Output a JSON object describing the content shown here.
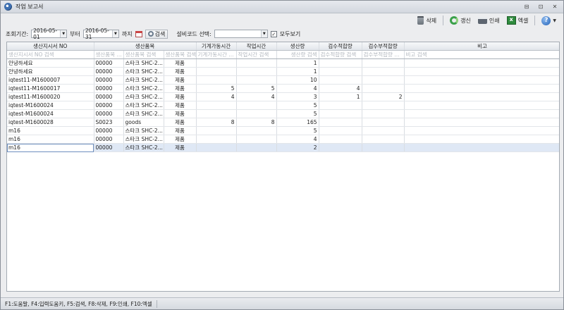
{
  "window": {
    "title": "작업 보고서",
    "min": "⊟",
    "restore": "⊡",
    "close": "✕"
  },
  "toolbar": {
    "delete": "삭제",
    "refresh": "갱신",
    "print": "인쇄",
    "excel": "엑셀",
    "help": "?"
  },
  "filter": {
    "period_label": "조회기간:",
    "from_date": "2016-05-01",
    "from_suffix": "부터",
    "to_date": "2016-05-31",
    "to_suffix": "까지",
    "search_label": "검색",
    "equipment_label": "설비코드 선택:",
    "equipment_value": "",
    "show_all_label": "모두보기",
    "show_all_checked": true
  },
  "grid": {
    "group_headers": [
      "생산지시서 NO",
      "생산품목",
      "기계가동시간",
      "작업시간",
      "생산량",
      "검수적합량",
      "검수부적합량",
      "비고"
    ],
    "filter_placeholders": [
      "생산지시서 NO 검색",
      "생산품목 ...",
      "생산품목 검색",
      "생산품목 검색",
      "기계가동시간 ...",
      "작업시간 검색",
      "생산량 검색",
      "검수적합량 검색",
      "검수부적합량 ...",
      "비고 검색"
    ],
    "rows": [
      [
        "안녕하세요",
        "00000",
        "스타크 SHC-2...",
        "제품",
        "",
        "",
        "1",
        "",
        "",
        ""
      ],
      [
        "안녕하세요",
        "00000",
        "스타크 SHC-2...",
        "제품",
        "",
        "",
        "1",
        "",
        "",
        ""
      ],
      [
        "iqtest11-M1600007",
        "00000",
        "스타크 SHC-2...",
        "제품",
        "",
        "",
        "10",
        "",
        "",
        ""
      ],
      [
        "iqtest11-M1600017",
        "00000",
        "스타크 SHC-2...",
        "제품",
        "5",
        "5",
        "4",
        "4",
        "",
        ""
      ],
      [
        "iqtest11-M1600020",
        "00000",
        "스타크 SHC-2...",
        "제품",
        "4",
        "4",
        "3",
        "1",
        "2",
        ""
      ],
      [
        "iqtest-M1600024",
        "00000",
        "스타크 SHC-2...",
        "제품",
        "",
        "",
        "5",
        "",
        "",
        ""
      ],
      [
        "iqtest-M1600024",
        "00000",
        "스타크 SHC-2...",
        "제품",
        "",
        "",
        "5",
        "",
        "",
        ""
      ],
      [
        "iqtest-M1600028",
        "S0023",
        "goods",
        "제품",
        "8",
        "8",
        "165",
        "",
        "",
        ""
      ],
      [
        "m16",
        "00000",
        "스타크 SHC-2...",
        "제품",
        "",
        "",
        "5",
        "",
        "",
        ""
      ],
      [
        "m16",
        "00000",
        "스타크 SHC-2...",
        "제품",
        "",
        "",
        "4",
        "",
        "",
        ""
      ],
      [
        "m16",
        "00000",
        "스타크 SHC-2...",
        "제품",
        "",
        "",
        "2",
        "",
        "",
        ""
      ]
    ]
  },
  "status": {
    "hotkeys": "F1:도움말, F4:입력도움키, F5:검색, F8:삭제, F9:인쇄, F10:엑셀"
  },
  "colors": {
    "selected_row": "#dfe8f5",
    "header_bg": "#e2e6eb"
  }
}
